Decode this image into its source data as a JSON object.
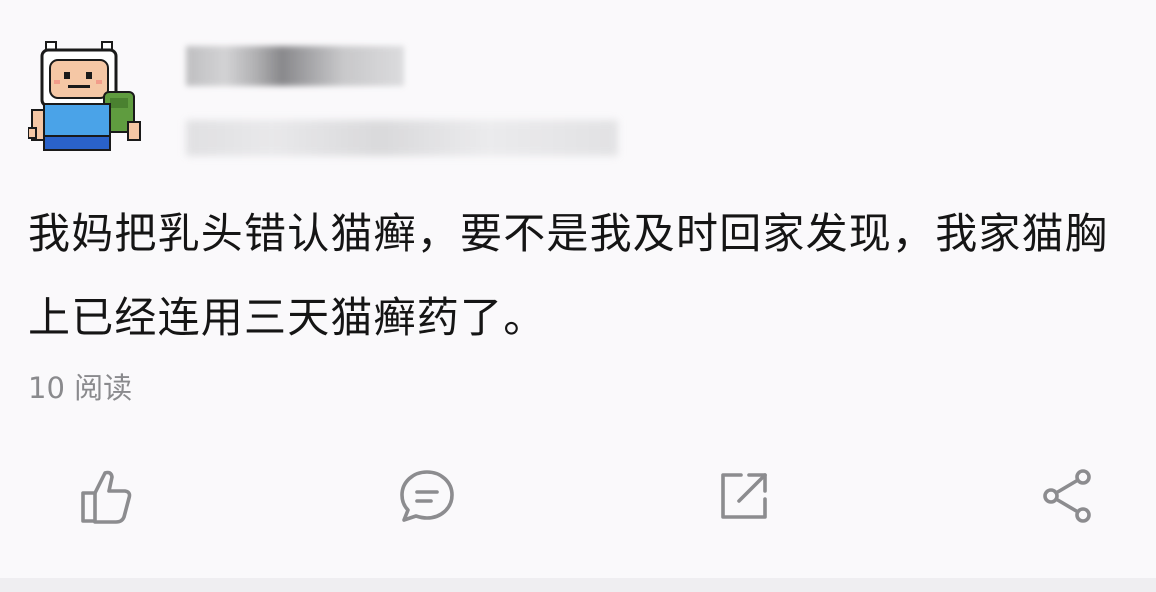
{
  "post": {
    "author": {
      "avatar_icon": "pixel-adventure-boy-avatar-icon"
    },
    "content": "我妈把乳头错认猫癣，要不是我及时回家发现，我家猫胸上已经连用三天猫癣药了。",
    "reads": "10 阅读"
  },
  "actions": {
    "like_icon": "thumbs-up-icon",
    "comment_icon": "comment-bubble-icon",
    "repost_icon": "repost-external-icon",
    "share_icon": "share-nodes-icon"
  },
  "colors": {
    "background": "#faf9fb",
    "text": "#151515",
    "muted": "#8a8a8d",
    "icon": "#8c8c8f"
  }
}
